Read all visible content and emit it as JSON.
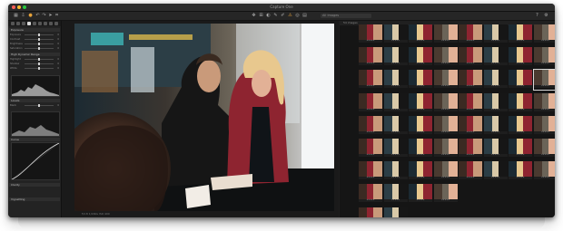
{
  "window": {
    "title": "Capture One"
  },
  "toolbar": {
    "icons": [
      "library-icon",
      "import-icon",
      "camera-icon",
      "undo-icon",
      "redo-icon",
      "cursor-icon",
      "crop-icon",
      "straighten-icon",
      "keystone-icon",
      "mask-icon",
      "picker-icon",
      "annotate-icon",
      "grid-view-icon",
      "proof-icon",
      "exposure-warning-icon",
      "help-icon",
      "settings-icon"
    ],
    "filter_placeholder": "All Images",
    "accent": "#e8a33a"
  },
  "toolpanel": {
    "sections": [
      "Exposure",
      "High Dynamic Range",
      "Levels",
      "Curve",
      "Clarity",
      "Vignetting"
    ],
    "controls": [
      {
        "label": "Exposure",
        "value": "0"
      },
      {
        "label": "Contrast",
        "value": "0"
      },
      {
        "label": "Brightness",
        "value": "0"
      },
      {
        "label": "Saturation",
        "value": "0"
      },
      {
        "label": "Highlight",
        "value": "0"
      },
      {
        "label": "Shadow",
        "value": "0"
      },
      {
        "label": "White",
        "value": "0"
      },
      {
        "label": "Black",
        "value": "0"
      }
    ]
  },
  "viewer": {
    "status": "f/2.8  1/160s  ISO 400"
  },
  "browser": {
    "count": "54 images",
    "thumbnail_caption": "★★★★★",
    "rows": 9,
    "columns": 8
  }
}
